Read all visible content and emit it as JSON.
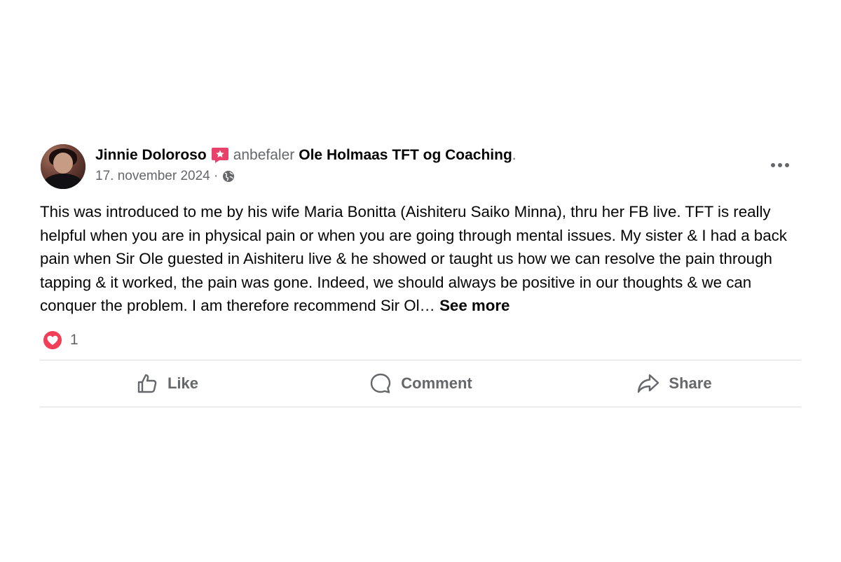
{
  "post": {
    "author": "Jinnie Doloroso",
    "verb": "anbefaler",
    "page": "Ole Holmaas TFT og Coaching",
    "date": "17. november 2024 ·",
    "text": "This was introduced to me by his wife Maria Bonitta (Aishiteru Saiko Minna), thru her FB live.  TFT is really helpful when you are in physical pain or when you are going through mental issues.  My sister & I had a back pain when Sir Ole guested in Aishiteru live & he showed or taught us how we can resolve the pain through tapping & it worked, the pain was gone.  Indeed, we should always be positive in our thoughts & we can conquer the problem.  I am therefore recommend Sir Ol…",
    "see_more": "See more",
    "reaction_count": "1"
  },
  "actions": {
    "like": "Like",
    "comment": "Comment",
    "share": "Share"
  },
  "icons": {
    "recommend": "recommend-icon",
    "audience": "globe-icon",
    "reaction": "love-reaction-icon",
    "menu": "more-options-icon"
  },
  "colors": {
    "recommend": "#e8416a",
    "love": "#f33e58",
    "secondary_text": "#65676b",
    "divider": "#dadde1"
  }
}
